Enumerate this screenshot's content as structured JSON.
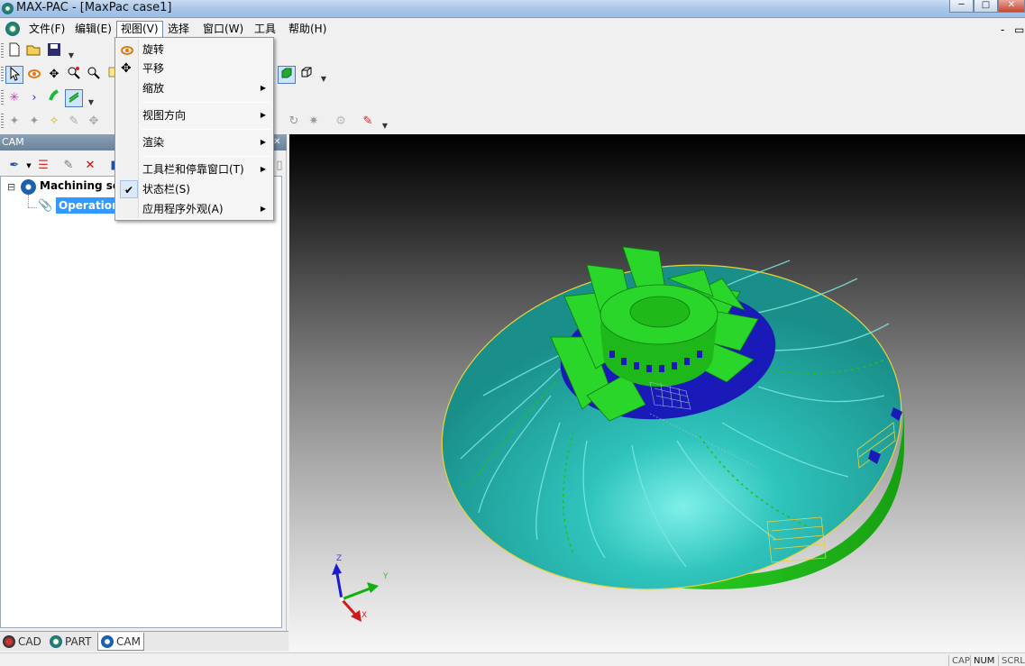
{
  "window": {
    "title": "MAX-PAC - [MaxPac case1]",
    "minimize": "─",
    "maximize": "□",
    "close": "✕"
  },
  "menubar": {
    "items": [
      {
        "label": "文件(F)"
      },
      {
        "label": "编辑(E)"
      },
      {
        "label": "视图(V)"
      },
      {
        "label": "选择"
      },
      {
        "label": "窗口(W)"
      },
      {
        "label": "工具"
      },
      {
        "label": "帮助(H)"
      }
    ],
    "mdi_minimize": "-",
    "mdi_restore": "▭"
  },
  "view_menu": {
    "items": [
      {
        "label": "旋转",
        "icon": "rotate-icon"
      },
      {
        "label": "平移",
        "icon": "pan-icon"
      },
      {
        "label": "缩放",
        "submenu": true
      },
      {
        "label": "视图方向",
        "submenu": true
      },
      {
        "label": "渲染",
        "submenu": true
      },
      {
        "label": "工具栏和停靠窗口(T)",
        "submenu": true
      },
      {
        "label": "状态栏(S)",
        "checked": true
      },
      {
        "label": "应用程序外观(A)",
        "submenu": true
      }
    ],
    "submenu_arrow": "▶",
    "check_glyph": "✔"
  },
  "cam_panel": {
    "title": "CAM",
    "close_glyph": "✕",
    "tree": {
      "root": {
        "label": "Machining se",
        "expander": "⊟"
      },
      "child": {
        "label": "Operation"
      }
    }
  },
  "bottom_tabs": [
    {
      "label": "CAD"
    },
    {
      "label": "PART"
    },
    {
      "label": "CAM"
    }
  ],
  "viewport": {
    "axes": {
      "x": "X",
      "y": "Y",
      "z": "Z"
    }
  },
  "statusbar": {
    "cap": "CAP",
    "num": "NUM",
    "scrl": "SCRL"
  },
  "colors": {
    "impeller_body": "#22c11c",
    "impeller_face": "#1fa3a0",
    "hub_blue": "#1a1ab8",
    "edge_yellow": "#e8d23a",
    "selection_blue": "#3399ff"
  }
}
